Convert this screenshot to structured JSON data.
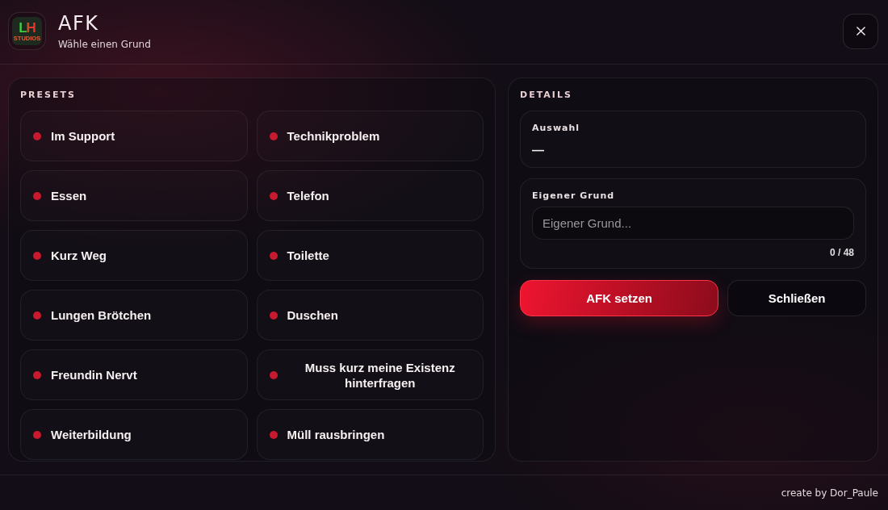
{
  "header": {
    "logo": {
      "letters": "LH",
      "caption": "STUDIOS"
    },
    "title": "AFK",
    "subtitle": "Wähle einen Grund"
  },
  "presets": {
    "title": "PRESETS",
    "items": [
      {
        "label": "Im Support",
        "selected": false
      },
      {
        "label": "Technikproblem",
        "selected": false
      },
      {
        "label": "Essen",
        "selected": false
      },
      {
        "label": "Telefon",
        "selected": false
      },
      {
        "label": "Kurz Weg",
        "selected": false
      },
      {
        "label": "Toilette",
        "selected": false
      },
      {
        "label": "Lungen Brötchen",
        "selected": false
      },
      {
        "label": "Duschen",
        "selected": false
      },
      {
        "label": "Freundin Nervt",
        "selected": false
      },
      {
        "label": "Muss kurz meine Existenz hinterfragen",
        "selected": false
      },
      {
        "label": "Weiterbildung",
        "selected": false
      },
      {
        "label": "Müll rausbringen",
        "selected": false
      }
    ]
  },
  "details": {
    "title": "DETAILS",
    "selection": {
      "label": "Auswahl",
      "value": "—"
    },
    "custom_reason": {
      "label": "Eigener Grund",
      "placeholder": "Eigener Grund...",
      "counter": "0 / 48"
    },
    "buttons": [
      {
        "label": "AFK setzen",
        "kind": "primary"
      },
      {
        "label": "Schließen",
        "kind": "secondary"
      }
    ]
  },
  "footer": {
    "credit": "create by Dor_Paule"
  }
}
